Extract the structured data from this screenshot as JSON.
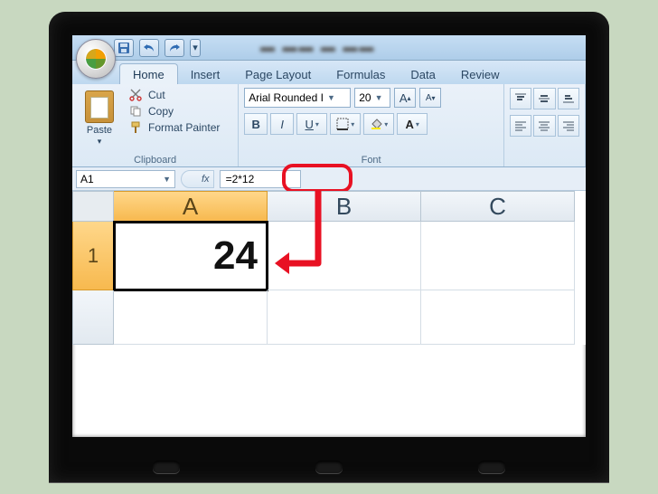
{
  "qat": {
    "save_title": "Save",
    "undo_title": "Undo",
    "redo_title": "Redo"
  },
  "tabs": {
    "home": "Home",
    "insert": "Insert",
    "page_layout": "Page Layout",
    "formulas": "Formulas",
    "data": "Data",
    "review": "Review"
  },
  "ribbon": {
    "clipboard": {
      "label": "Clipboard",
      "paste": "Paste",
      "cut": "Cut",
      "copy": "Copy",
      "format_painter": "Format Painter"
    },
    "font": {
      "label": "Font",
      "name": "Arial Rounded I",
      "size": "20",
      "bold": "B",
      "italic": "I",
      "underline": "U",
      "grow": "A",
      "shrink": "A"
    }
  },
  "formula_bar": {
    "name_box": "A1",
    "fx": "fx",
    "formula": "=2*12"
  },
  "grid": {
    "columns": [
      "A",
      "B",
      "C"
    ],
    "rows": [
      "1"
    ],
    "cells": {
      "A1": "24"
    },
    "active": "A1"
  },
  "colors": {
    "highlight": "#e81123",
    "ribbon_bg": "#dce9f5",
    "selected_header": "#f7b94f"
  }
}
